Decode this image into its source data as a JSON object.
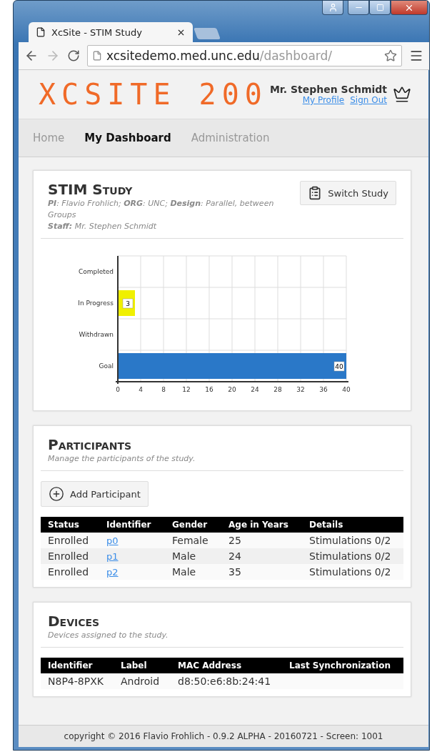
{
  "browser": {
    "tab": {
      "title": "XcSite - STIM Study"
    },
    "url": {
      "host": "xcsitedemo.med.unc.edu",
      "path": "/dashboard/"
    }
  },
  "header": {
    "logo": "XCSITE 200",
    "user": "Mr. Stephen Schmidt",
    "links": [
      "My Profile",
      "Sign Out"
    ]
  },
  "nav": [
    {
      "label": "Home",
      "selected": false
    },
    {
      "label": "My Dashboard",
      "selected": true
    },
    {
      "label": "Administration",
      "selected": false
    }
  ],
  "study": {
    "title": "STIM Study",
    "meta": [
      "**PI**: Flavio Frohlich; **ORG**: UNC; **Design**: Parallel, between Groups",
      "**Staff:** Mr. Stephen Schmidt"
    ],
    "button": "Switch Study",
    "chart_data": {
      "type": "bar",
      "orientation": "horizontal",
      "categories": [
        "Completed",
        "In Progress",
        "Withdrawn",
        "Goal"
      ],
      "series": [
        {
          "color": "#f0f000",
          "values": [
            null,
            3,
            null,
            null
          ]
        },
        {
          "color": "#2a78c8",
          "values": [
            null,
            null,
            null,
            40
          ]
        }
      ],
      "grid": true,
      "xlim": [
        0,
        40
      ],
      "xticks": [
        0,
        4,
        8,
        12,
        16,
        20,
        24,
        28,
        32,
        36,
        40
      ],
      "data_labels": true
    }
  },
  "participants": {
    "title": "Participants",
    "subtitle": "Manage the participants of the study.",
    "button": "Add Participant",
    "columns": [
      "Status",
      "Identifier",
      "Gender",
      "Age in Years",
      "Details"
    ],
    "rows": [
      [
        "Enrolled",
        "p0",
        "Female",
        "25",
        "Stimulations 0/2"
      ],
      [
        "Enrolled",
        "p1",
        "Male",
        "24",
        "Stimulations 0/2"
      ],
      [
        "Enrolled",
        "p2",
        "Male",
        "35",
        "Stimulations 0/2"
      ]
    ]
  },
  "devices": {
    "title": "Devices",
    "subtitle": "Devices assigned to the study.",
    "columns": [
      "Identifier",
      "Label",
      "MAC Address",
      "Last Synchronization"
    ],
    "rows": [
      [
        "N8P4-8PXK",
        "Android",
        "d8:50:e6:8b:24:41",
        ""
      ]
    ]
  },
  "footer": "copyright © 2016 Flavio Frohlich - 0.9.2 ALPHA - 20160721 - Screen: 1001"
}
